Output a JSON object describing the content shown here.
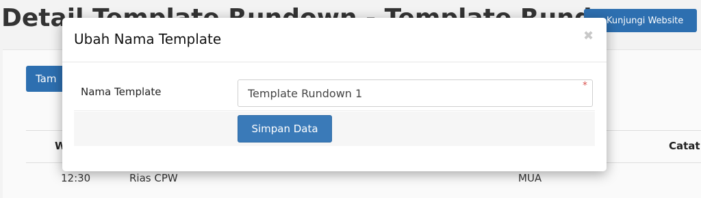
{
  "background": {
    "page_title": "Detail Template Rundown - Template Rundown",
    "visit_button_icon": "external-link-icon",
    "visit_button_label": "Kunjungi Website",
    "add_button_label": "Tam",
    "table": {
      "col_first": "W",
      "col_notes": "Catat",
      "rows": [
        {
          "time": "12:30",
          "activity": "Rias CPW",
          "pic": "MUA"
        }
      ]
    }
  },
  "modal": {
    "title": "Ubah Nama Template",
    "close_icon": "close-icon",
    "field_label": "Nama Template",
    "field_value": "Template Rundown 1",
    "required_mark": "*",
    "save_label": "Simpan Data"
  }
}
